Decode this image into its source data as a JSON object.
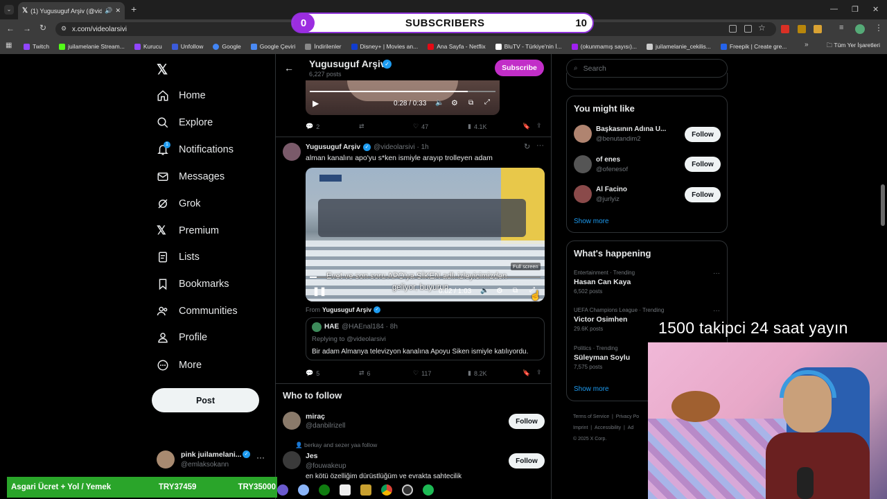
{
  "browser": {
    "tab_title": "(1) Yugusuguf Arşiv (@vide...",
    "url": "x.com/videolarsivi",
    "bookmarks": [
      "Twitch",
      "juilamelanie Stream...",
      "Kurucu",
      "Unfollow",
      "Google",
      "Google Çeviri",
      "İndirilenler",
      "Disney+ | Movies an...",
      "Ana Sayfa - Netflix",
      "BluTV - Türkiye'nin İ...",
      "(okunmamış sayısı)...",
      "juilamelanie_cekilis...",
      "Freepik | Create gre..."
    ],
    "bookmarks_right": "Tüm Yer İşaretleri"
  },
  "overlay": {
    "subs_count": "0",
    "subs_label": "SUBSCRIBERS",
    "subs_goal": "10",
    "stream_text": "1500 takipci 24 saat yayın",
    "goal_label": "Asgari Ücret + Yol / Yemek",
    "goal_current": "TRY37459",
    "goal_target": "TRY35000"
  },
  "nav": {
    "items": [
      "Home",
      "Explore",
      "Notifications",
      "Messages",
      "Grok",
      "Premium",
      "Lists",
      "Bookmarks",
      "Communities",
      "Profile",
      "More"
    ],
    "notif_badge": "1",
    "post": "Post",
    "account_name": "pink juilamelani...",
    "account_handle": "@emlaksokann"
  },
  "header": {
    "name": "Yugusuguf Arşiv",
    "posts": "6,227 posts",
    "subscribe": "Subscribe"
  },
  "tweet1": {
    "time": "0:28 / 0:33",
    "replies": "2",
    "likes": "47",
    "views": "4.1K"
  },
  "tweet2": {
    "name": "Yugusuguf Arşiv",
    "handle": "@videolarsivi · 1h",
    "text": "alman kanalını apo'yu s*ken ismiyle arayıp trolleyen adam",
    "subtitle1": "Evet ve son soru APO'ya SİKEN adlı izleyicimizden",
    "subtitle2": "geliyor, buyurun",
    "fullscreen": "Full screen",
    "time": "0:02 / 1:03",
    "from_label": "From",
    "from_name": "Yugusuguf Arşiv",
    "quote_name": "HAE",
    "quote_handle": "@HAEnal184 · 8h",
    "quote_replying": "Replying to @videolarsivi",
    "quote_text": "Bir adam Almanya televizyon kanalına Apoyu Siken ismiyle katılıyordu.",
    "replies": "5",
    "retweets": "6",
    "likes": "117",
    "views": "8.2K"
  },
  "who_to_follow": {
    "title": "Who to follow",
    "items": [
      {
        "name": "miraç",
        "handle": "@danbilrizell",
        "social": "",
        "bio": "",
        "follow": "Follow"
      },
      {
        "name": "Jes",
        "handle": "@fouwakeup",
        "social": "berkay and sezer yaa follow",
        "bio": "en kötü özelliğim dürüstlüğüm ve evrakta sahtecilik",
        "follow": "Follow"
      }
    ]
  },
  "search": {
    "placeholder": "Search"
  },
  "might_like": {
    "title": "You might like",
    "items": [
      {
        "name": "Başkasının Adına U...",
        "handle": "@benutandim2",
        "follow": "Follow"
      },
      {
        "name": "of enes",
        "handle": "@ofenesof",
        "follow": "Follow"
      },
      {
        "name": "Al Facino",
        "handle": "@jurlyiz",
        "follow": "Follow"
      }
    ],
    "show_more": "Show more"
  },
  "happening": {
    "title": "What's happening",
    "trends": [
      {
        "category": "Entertainment · Trending",
        "name": "Hasan Can Kaya",
        "posts": "6,502 posts"
      },
      {
        "category": "UEFA Champions League · Trending",
        "name": "Victor Osimhen",
        "posts": "29.6K posts"
      },
      {
        "category": "Politics · Trending",
        "name": "Süleyman Soylu",
        "posts": "7,575 posts"
      }
    ],
    "show_more": "Show more"
  },
  "footer": {
    "terms": "Terms of Service",
    "privacy": "Privacy Po",
    "imprint": "Imprint",
    "accessibility": "Accessibility",
    "ads": "Ad",
    "copyright": "© 2025 X Corp."
  },
  "colors": {
    "accent_purple": "#9b2de0",
    "subscribe_purple": "#c22ec8",
    "verified_blue": "#1d9bf0",
    "goal_green": "#2aa52a"
  }
}
